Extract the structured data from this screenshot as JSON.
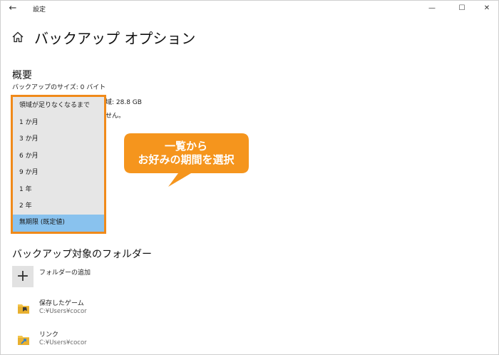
{
  "window": {
    "title": "設定"
  },
  "page": {
    "title": "バックアップ オプション"
  },
  "overview": {
    "heading": "概要",
    "backup_size": "バックアップのサイズ: 0 バイト",
    "partial_line_1": "域: 28.8 GB",
    "partial_line_2": "せん。"
  },
  "dropdown": {
    "options": [
      "領域が足りなくなるまで",
      "1 か月",
      "3 か月",
      "6 か月",
      "9 か月",
      "1 年",
      "2 年",
      "無期限 (既定値)"
    ],
    "selected": "無期限 (既定値)",
    "highlight_color": "#89c2ee",
    "border_color": "#f08a1a"
  },
  "callout": {
    "line1": "一覧から",
    "line2": "お好みの期間を選択",
    "color": "#f5951d"
  },
  "folders": {
    "heading": "バックアップ対象のフォルダー",
    "add_label": "フォルダーの追加",
    "items": [
      {
        "name": "保存したゲーム",
        "path": "C:¥Users¥cocor"
      },
      {
        "name": "リンク",
        "path": "C:¥Users¥cocor"
      }
    ]
  }
}
